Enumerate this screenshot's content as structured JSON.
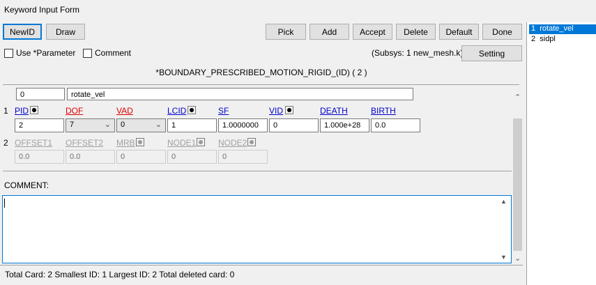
{
  "window": {
    "title": "Keyword Input Form"
  },
  "toolbar": {
    "newid": "NewID",
    "draw": "Draw",
    "pick": "Pick",
    "add": "Add",
    "accept": "Accept",
    "delete": "Delete",
    "default": "Default",
    "done": "Done",
    "setting": "Setting"
  },
  "options": {
    "use_parameter": "Use *Parameter",
    "comment": "Comment"
  },
  "subsys": "(Subsys: 1 new_mesh.k)",
  "keyword": "*BOUNDARY_PRESCRIBED_MOTION_RIGID_(ID)    ( 2 )",
  "id_row": {
    "id": "0",
    "heading": "rotate_vel"
  },
  "card1": {
    "num": "1",
    "labels": [
      "PID",
      "DOF",
      "VAD",
      "LCID",
      "SF",
      "VID",
      "DEATH",
      "BIRTH"
    ],
    "values": [
      "2",
      "7",
      "0",
      "1",
      "1.0000000",
      "0",
      "1.000e+28",
      "0.0"
    ]
  },
  "card2": {
    "num": "2",
    "labels": [
      "OFFSET1",
      "OFFSET2",
      "MRB",
      "NODE1",
      "NODE2"
    ],
    "values": [
      "0.0",
      "0.0",
      "0",
      "0",
      "0"
    ]
  },
  "comment_label": "COMMENT:",
  "status": "Total Card: 2    Smallest ID: 1    Largest ID: 2    Total deleted card:  0",
  "list": [
    {
      "num": "1",
      "name": "rotate_vel"
    },
    {
      "num": "2",
      "name": "sidpl"
    }
  ],
  "colors": {
    "accent": "#0078d7",
    "link": "#0000cc",
    "required": "#e00000"
  }
}
